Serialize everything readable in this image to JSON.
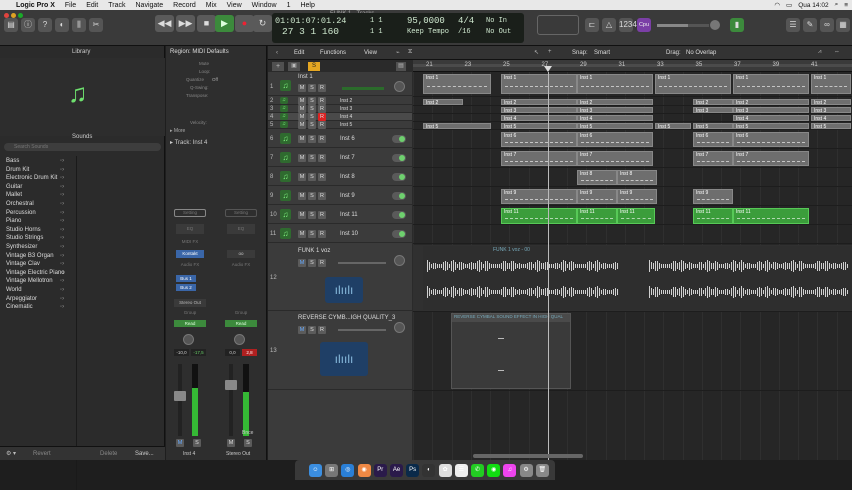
{
  "menubar": {
    "apple": "",
    "app": "Logic Pro X",
    "items": [
      "File",
      "Edit",
      "Track",
      "Navigate",
      "Record",
      "Mix",
      "View",
      "Window",
      "1",
      "Help"
    ],
    "clock": "Qua 14:02"
  },
  "window_title": "FUNK 1 - Tracks",
  "lcd": {
    "time": "01:01:07:01.24",
    "bars": "27  3  1  160",
    "sub1": "1    1",
    "sub2": "1    1",
    "tempo": "95,0000",
    "tempo_mode": "Keep Tempo",
    "sig": "4/4",
    "div": "/16",
    "in": "No In",
    "out": "No Out"
  },
  "key_label": "Cpu",
  "library": {
    "title": "Library",
    "sounds": "Sounds",
    "search": "Search Sounds",
    "items": [
      "Bass",
      "Drum Kit",
      "Electronic Drum Kit",
      "Guitar",
      "Mallet",
      "Orchestral",
      "Percussion",
      "Piano",
      "Studio Horns",
      "Studio Strings",
      "Synthesizer",
      "Vintage B3 Organ",
      "Vintage Clav",
      "Vintage Electric Piano",
      "Vintage Mellotron",
      "World",
      "Arpeggiator",
      "Cinematic"
    ],
    "revert": "Revert",
    "delete": "Delete",
    "save": "Save..."
  },
  "inspector": {
    "region": "Region: MIDI Defaults",
    "mute": "Mute",
    "loop": "Loop:",
    "quantize": "Quantize",
    "quant_val": "Off",
    "qswing": "Q-Swing:",
    "transpose": "Transpose:",
    "velocity": "Velocity:",
    "more": "More",
    "track": "Track: Inst 4",
    "strip1": {
      "setting": "Setting",
      "eq": "EQ",
      "midi_fx": "MIDI FX",
      "inst": "Kontakt",
      "audio_fx": "Audio FX",
      "sends": [
        "Bus 1",
        "Bus 2"
      ],
      "output": "Stereo Out",
      "group": "Group",
      "auto": "Read",
      "pan_db": "-10,0",
      "peak": "-17,5",
      "name": "Inst 4"
    },
    "strip2": {
      "setting": "Setting",
      "eq": "EQ",
      "audio_fx": "Audio FX",
      "link": "Stereo Out",
      "group": "Group",
      "auto": "Read",
      "pan_db": "0,0",
      "peak": "2,8",
      "bnce": "Bnce",
      "name": "Stereo Out"
    }
  },
  "toolbar2": {
    "edit": "Edit",
    "functions": "Functions",
    "view": "View",
    "snap": "Snap:",
    "snap_val": "Smart",
    "drag": "Drag:",
    "drag_val": "No Overlap"
  },
  "ruler": [
    "21",
    "23",
    "25",
    "27",
    "29",
    "31",
    "33",
    "35",
    "37",
    "39",
    "41"
  ],
  "tracks": [
    {
      "num": "1",
      "name": "Inst 1"
    },
    {
      "num": "2",
      "name": "Inst 2"
    },
    {
      "num": "3",
      "name": "Inst 3"
    },
    {
      "num": "4",
      "name": "Inst 4"
    },
    {
      "num": "5",
      "name": "Inst 5"
    },
    {
      "num": "6",
      "name": "Inst 6"
    },
    {
      "num": "7",
      "name": "Inst 7"
    },
    {
      "num": "8",
      "name": "Inst 8"
    },
    {
      "num": "9",
      "name": "Inst 9"
    },
    {
      "num": "10",
      "name": "Inst 11"
    },
    {
      "num": "11",
      "name": "Inst 10"
    },
    {
      "num": "12",
      "name": "FUNK 1 voz"
    },
    {
      "num": "13",
      "name": "REVERSE CYMB...IGH QUALITY_3"
    }
  ],
  "regions": {
    "inst1": "Inst 1",
    "inst2": "Inst 2",
    "inst3": "Inst 3",
    "inst4": "Inst 4",
    "inst5": "Inst 5",
    "inst6": "Inst 6",
    "inst7": "Inst 7",
    "inst8": "Inst 8",
    "inst9": "Inst 9",
    "inst11": "Inst 11",
    "audio1": "FUNK 1 voz - 00",
    "audio2": "REVERSE CYMBAL SOUND EFFECT IN HIGH QUAL"
  },
  "msr": {
    "m": "M",
    "s": "S",
    "r": "R"
  }
}
